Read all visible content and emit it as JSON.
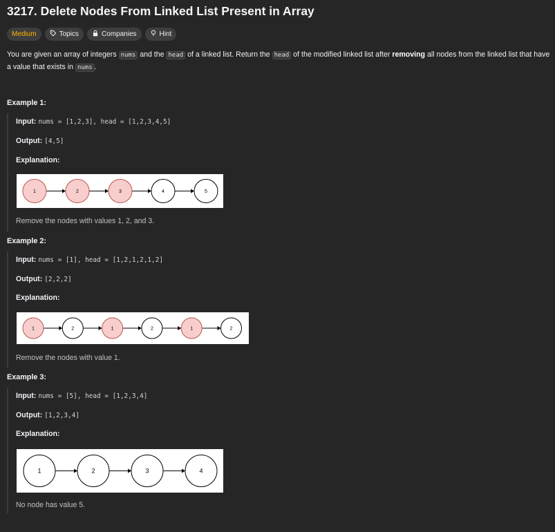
{
  "problem": {
    "title": "3217. Delete Nodes From Linked List Present in Array",
    "tags": {
      "difficulty": "Medium",
      "topics": "Topics",
      "companies": "Companies",
      "hint": "Hint"
    },
    "description": {
      "p1": "You are given an array of integers ",
      "code1": "nums",
      "p2": " and the ",
      "code2": "head",
      "p3": " of a linked list. Return the ",
      "code3": "head",
      "p4": " of the modified linked list after ",
      "bold": "removing",
      "p5": " all nodes from the linked list that have a value that exists in ",
      "code4": "nums",
      "p6": "."
    }
  },
  "labels": {
    "input": "Input:",
    "output": "Output:",
    "explanation": "Explanation:"
  },
  "examples": [
    {
      "title": "Example 1:",
      "input": "nums = [1,2,3], head = [1,2,3,4,5]",
      "output": "[4,5]",
      "nodes": [
        {
          "value": "1",
          "removed": true
        },
        {
          "value": "2",
          "removed": true
        },
        {
          "value": "3",
          "removed": true
        },
        {
          "value": "4",
          "removed": false
        },
        {
          "value": "5",
          "removed": false
        }
      ],
      "note": "Remove the nodes with values 1, 2, and 3."
    },
    {
      "title": "Example 2:",
      "input": "nums = [1], head = [1,2,1,2,1,2]",
      "output": "[2,2,2]",
      "nodes": [
        {
          "value": "1",
          "removed": true
        },
        {
          "value": "2",
          "removed": false
        },
        {
          "value": "1",
          "removed": true
        },
        {
          "value": "2",
          "removed": false
        },
        {
          "value": "1",
          "removed": true
        },
        {
          "value": "2",
          "removed": false
        }
      ],
      "note": "Remove the nodes with value 1."
    },
    {
      "title": "Example 3:",
      "input": "nums = [5], head = [1,2,3,4]",
      "output": "[1,2,3,4]",
      "nodes": [
        {
          "value": "1",
          "removed": false
        },
        {
          "value": "2",
          "removed": false
        },
        {
          "value": "3",
          "removed": false
        },
        {
          "value": "4",
          "removed": false
        }
      ],
      "note": "No node has value 5."
    }
  ],
  "colors": {
    "difficulty": "#ffb800",
    "removed_fill": "#f8cecc",
    "removed_stroke": "#b85450",
    "node_fill": "#ffffff",
    "node_stroke": "#000000"
  }
}
